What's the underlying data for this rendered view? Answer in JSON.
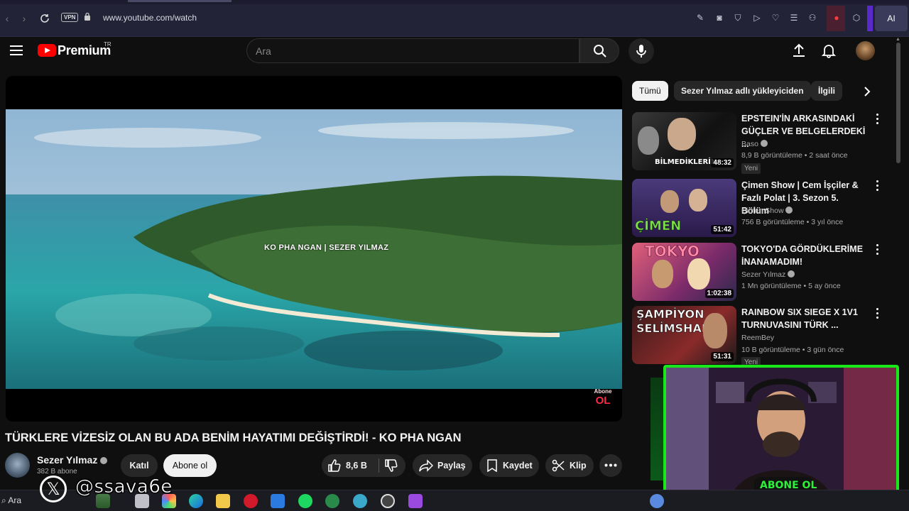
{
  "browser": {
    "url": "www.youtube.com/watch",
    "vpn_label": "VPN",
    "ai_label": "AI"
  },
  "header": {
    "logo_text": "Premium",
    "region": "TR",
    "search_placeholder": "Ara"
  },
  "player": {
    "overlay_text": "KO PHA NGAN | SEZER YILMAZ",
    "subscribe_watermark": "Abone OL"
  },
  "video": {
    "title": "TÜRKLERE VİZESİZ OLAN BU ADA BENİM HAYATIMI DEĞİŞTİRDİ! - KO PHA NGAN",
    "channel": "Sezer Yılmaz",
    "subscribers": "382 B abone",
    "join_label": "Katıl",
    "subscribe_label": "Abone ol",
    "likes": "8,6 B",
    "share_label": "Paylaş",
    "save_label": "Kaydet",
    "clip_label": "Klip"
  },
  "chips": [
    "Tümü",
    "Sezer Yılmaz adlı yükleyiciden",
    "İlgili"
  ],
  "related": [
    {
      "title": "EPSTEIN'İN ARKASINDAKİ GÜÇLER VE BELGELERDEKİ ...",
      "channel": "Baso",
      "verified": true,
      "stats": "8,9 B görüntüleme • 2 saat önce",
      "badge": "Yeni",
      "duration": "48:32",
      "thumb_text": "BİLMEDİKLERİN"
    },
    {
      "title": "Çimen Show | Cem İşçiler & Fazlı Polat | 3. Sezon 5. Bölüm",
      "channel": "Çimen Show",
      "verified": true,
      "stats": "756 B görüntüleme • 3 yıl önce",
      "duration": "51:42",
      "thumb_text": "ÇİMEN"
    },
    {
      "title": "TOKYO'DA GÖRDÜKLERİME İNANAMADIM!",
      "channel": "Sezer Yılmaz",
      "verified": true,
      "stats": "1 Mn görüntüleme • 5 ay önce",
      "duration": "1:02:38",
      "thumb_text": "TOKYO"
    },
    {
      "title": "RAINBOW SIX SIEGE X 1V1 TURNUVASINI TÜRK ...",
      "channel": "ReemBey",
      "verified": false,
      "stats": "10 B görüntüleme • 3 gün önce",
      "badge": "Yeni",
      "duration": "51:31",
      "thumb_text": "ŞAMPİYON SELİMSHADY"
    }
  ],
  "webcam": {
    "banner": "ABONE OL"
  },
  "social": {
    "handle": "@ssava6e"
  },
  "taskbar": {
    "search_label": "Ara"
  }
}
